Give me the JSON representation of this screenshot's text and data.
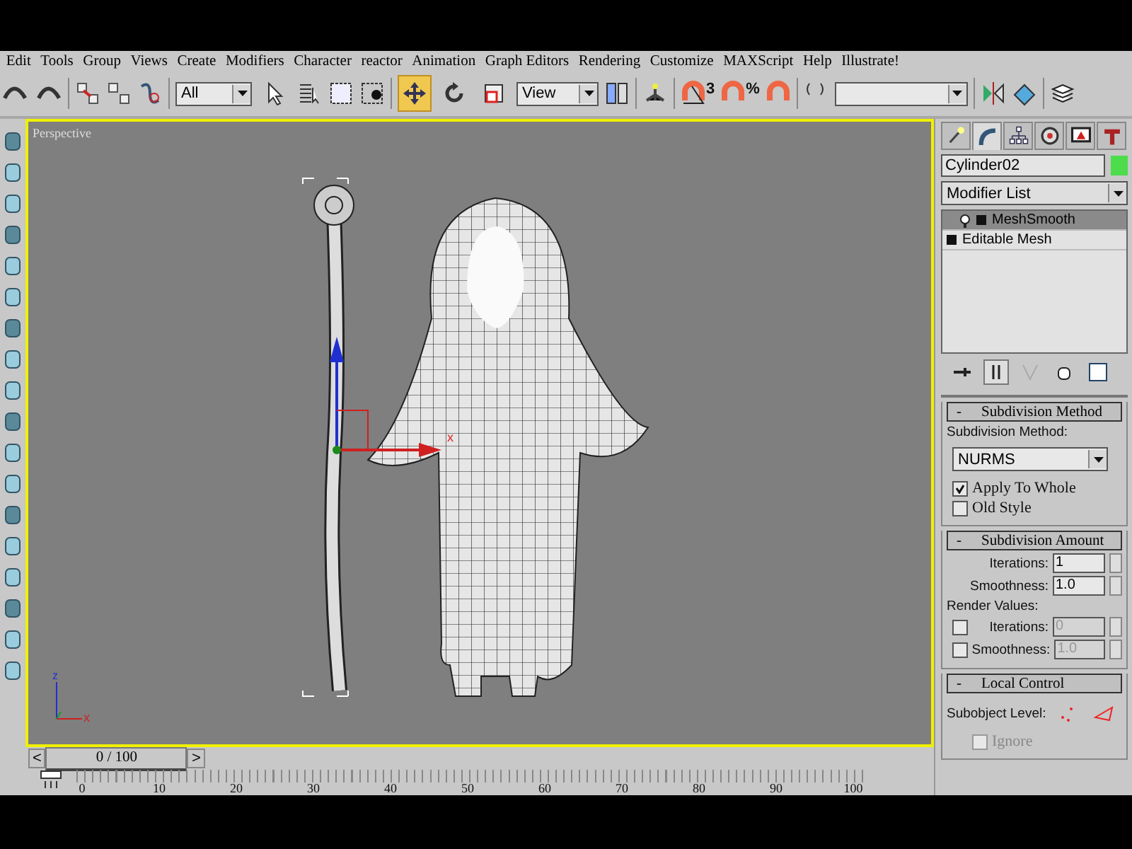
{
  "menu": [
    "Edit",
    "Tools",
    "Group",
    "Views",
    "Create",
    "Modifiers",
    "Character",
    "reactor",
    "Animation",
    "Graph Editors",
    "Rendering",
    "Customize",
    "MAXScript",
    "Help",
    "Illustrate!"
  ],
  "toolbar": {
    "selection_filter": "All",
    "reference_coordinate": "View",
    "transform_tools": [
      {
        "kind": "select",
        "selected": false
      },
      {
        "kind": "move",
        "selected": true
      },
      {
        "kind": "rotate",
        "selected": false
      },
      {
        "kind": "scale",
        "selected": false
      }
    ],
    "snap_labels": [
      {
        "kind": "angle",
        "text": "3"
      },
      {
        "kind": "percent",
        "text": "%"
      }
    ]
  },
  "viewport": {
    "label": "Perspective",
    "gizmo_axis": "x",
    "corner_axes": [
      "z",
      "x"
    ]
  },
  "command_panel": {
    "tabs": [
      {
        "kind": "create",
        "selected": false
      },
      {
        "kind": "modify",
        "selected": true
      },
      {
        "kind": "hierarchy",
        "selected": false
      },
      {
        "kind": "motion",
        "selected": false
      },
      {
        "kind": "display",
        "selected": false
      },
      {
        "kind": "utilities",
        "selected": false
      }
    ],
    "object_name": "Cylinder02",
    "swatch": {
      "color": "#4cdc4c"
    },
    "modifier_list": "Modifier List",
    "stack": [
      {
        "name": "MeshSmooth",
        "selected": true,
        "kind": "modifier"
      },
      {
        "name": "Editable Mesh",
        "selected": false,
        "kind": "base"
      }
    ],
    "rollouts": [
      {
        "kind": "method",
        "toggle": "-",
        "title": "Subdivision Method",
        "method_label": "Subdivision Method:",
        "method": "NURMS",
        "checks": [
          {
            "label": "Apply To Whole",
            "checked": true
          },
          {
            "label": "Old Style",
            "checked": false
          }
        ]
      },
      {
        "kind": "amount",
        "toggle": "-",
        "title": "Subdivision Amount",
        "spinners": [
          {
            "label": "Iterations:",
            "value": "1"
          },
          {
            "label": "Smoothness:",
            "value": "1.0"
          }
        ],
        "render_label": "Render Values:",
        "render_spinners": [
          {
            "label": "Iterations:",
            "value": "0",
            "checked": false,
            "disabled": true
          },
          {
            "label": "Smoothness:",
            "value": "1.0",
            "checked": false,
            "disabled": true
          }
        ]
      },
      {
        "kind": "local",
        "toggle": "-",
        "title": "Local Control",
        "level_label": "Subobject Level:",
        "ignore": {
          "label": "Ignore",
          "checked": false,
          "disabled": true
        }
      }
    ]
  },
  "time_slider": {
    "prev": "<",
    "position": "0 / 100",
    "level": 0,
    "next": ">"
  },
  "track_ticks": [
    "0",
    "10",
    "20",
    "30",
    "40",
    "50",
    "60",
    "70",
    "80",
    "90",
    "100"
  ]
}
